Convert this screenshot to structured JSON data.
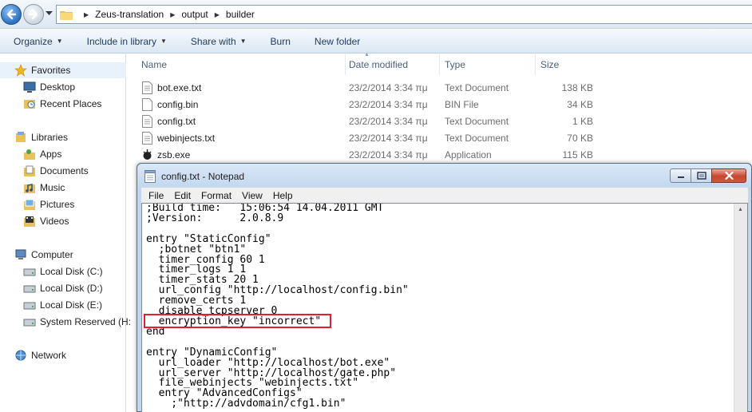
{
  "explorer": {
    "breadcrumb": [
      "Zeus-translation",
      "output",
      "builder"
    ],
    "commands": [
      "Organize",
      "Include in library",
      "Share with",
      "Burn",
      "New folder"
    ],
    "nav": {
      "favorites": "Favorites",
      "favorites_items": [
        "Desktop",
        "Recent Places"
      ],
      "libraries": "Libraries",
      "libraries_items": [
        "Apps",
        "Documents",
        "Music",
        "Pictures",
        "Videos"
      ],
      "computer": "Computer",
      "computer_items": [
        "Local Disk (C:)",
        "Local Disk (D:)",
        "Local Disk (E:)",
        "System Reserved (H:"
      ],
      "network": "Network"
    },
    "columns": [
      "Name",
      "Date modified",
      "Type",
      "Size"
    ],
    "files": [
      {
        "name": "bot.exe.txt",
        "date": "23/2/2014 3:34 πμ",
        "type": "Text Document",
        "size": "138 KB",
        "icon": "text-file-icon"
      },
      {
        "name": "config.bin",
        "date": "23/2/2014 3:34 πμ",
        "type": "BIN File",
        "size": "34 KB",
        "icon": "file-icon"
      },
      {
        "name": "config.txt",
        "date": "23/2/2014 3:34 πμ",
        "type": "Text Document",
        "size": "1 KB",
        "icon": "text-file-icon"
      },
      {
        "name": "webinjects.txt",
        "date": "23/2/2014 3:34 πμ",
        "type": "Text Document",
        "size": "70 KB",
        "icon": "text-file-icon"
      },
      {
        "name": "zsb.exe",
        "date": "23/2/2014 3:34 πμ",
        "type": "Application",
        "size": "115 KB",
        "icon": "app-icon"
      }
    ]
  },
  "notepad": {
    "title": "config.txt - Notepad",
    "menu": [
      "File",
      "Edit",
      "Format",
      "View",
      "Help"
    ],
    "lines": [
      ";Build time:   15:06:54 14.04.2011 GMT",
      ";Version:      2.0.8.9",
      "",
      "entry \"StaticConfig\"",
      "  ;botnet \"btn1\"",
      "  timer_config 60 1",
      "  timer_logs 1 1",
      "  timer_stats 20 1",
      "  url_config \"http://localhost/config.bin\"",
      "  remove_certs 1",
      "  disable_tcpserver 0",
      "  encryption_key \"incorrect\"",
      "end",
      "",
      "entry \"DynamicConfig\"",
      "  url_loader \"http://localhost/bot.exe\"",
      "  url_server \"http://localhost/gate.php\"",
      "  file_webinjects \"webinjects.txt\"",
      "  entry \"AdvancedConfigs\"",
      "    ;\"http://advdomain/cfg1.bin\""
    ]
  },
  "colors": {
    "highlight": "#e0202a",
    "command_text": "#1e395b",
    "header_text": "#4c607a",
    "meta_text": "#6d6d6d"
  }
}
